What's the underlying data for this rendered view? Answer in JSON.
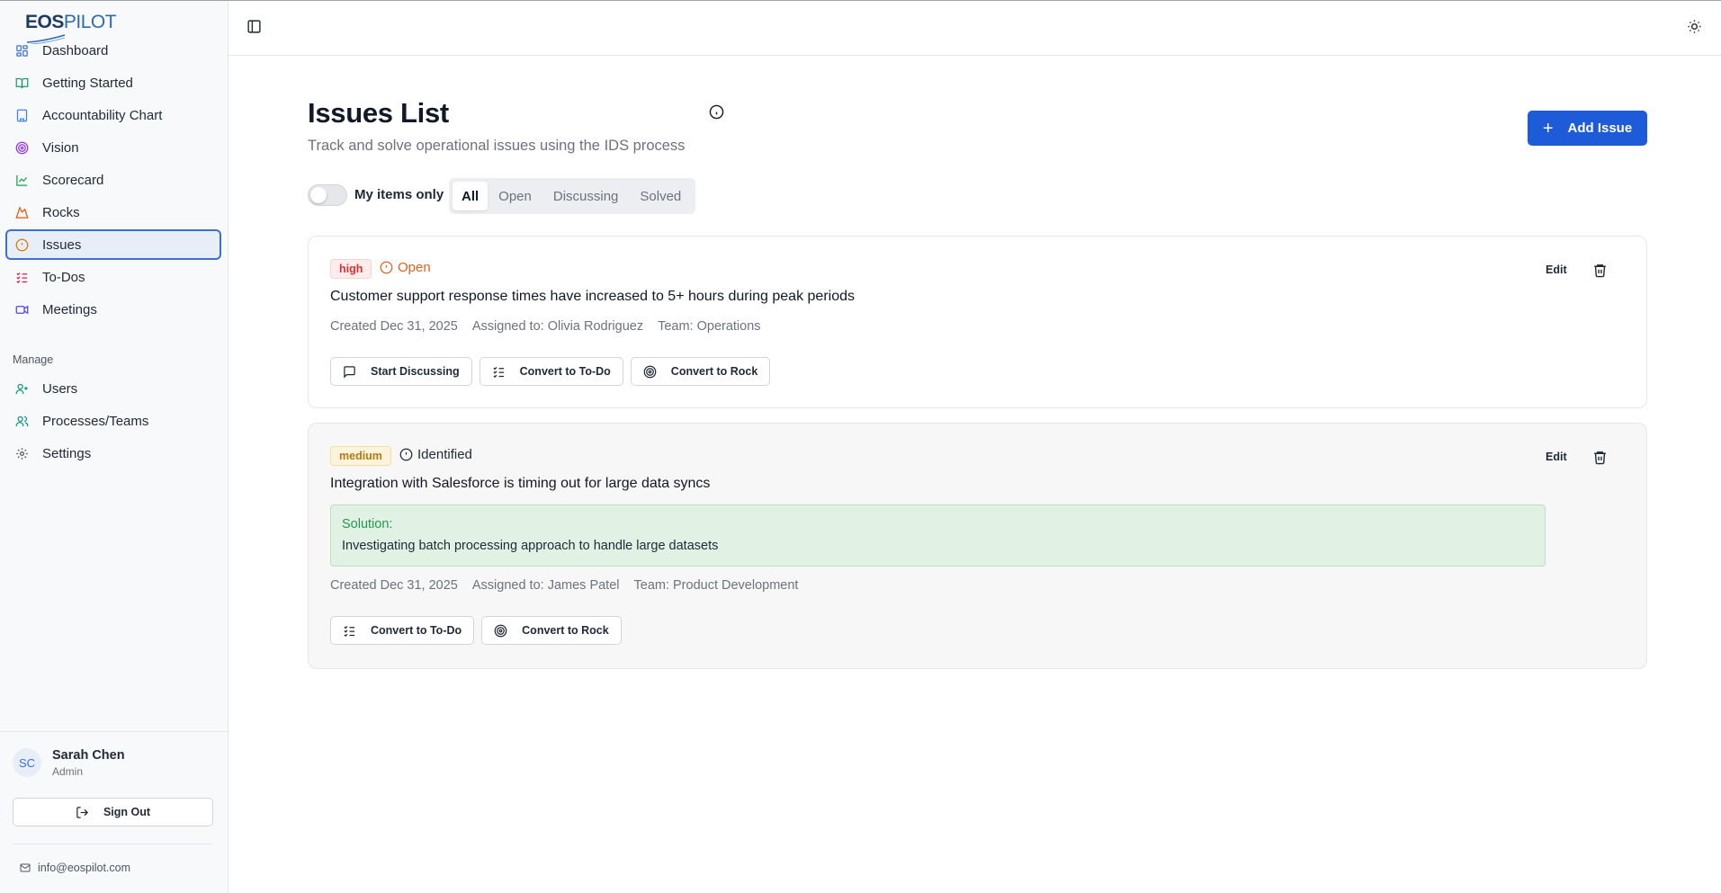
{
  "app": {
    "logo_primary": "EOS",
    "logo_secondary": "PILOT"
  },
  "sidebar": {
    "items": [
      {
        "label": "Dashboard",
        "icon": "dashboard-icon",
        "active": false
      },
      {
        "label": "Getting Started",
        "icon": "book-icon",
        "active": false
      },
      {
        "label": "Accountability Chart",
        "icon": "org-chart-icon",
        "active": false
      },
      {
        "label": "Vision",
        "icon": "target-icon",
        "active": false
      },
      {
        "label": "Scorecard",
        "icon": "chart-line-icon",
        "active": false
      },
      {
        "label": "Rocks",
        "icon": "mountain-icon",
        "active": false
      },
      {
        "label": "Issues",
        "icon": "alert-circle-icon",
        "active": true
      },
      {
        "label": "To-Dos",
        "icon": "checklist-icon",
        "active": false
      },
      {
        "label": "Meetings",
        "icon": "video-icon",
        "active": false
      }
    ],
    "section_label": "Manage",
    "manage_items": [
      {
        "label": "Users",
        "icon": "user-plus-icon"
      },
      {
        "label": "Processes/Teams",
        "icon": "users-icon"
      },
      {
        "label": "Settings",
        "icon": "gear-icon"
      }
    ],
    "user": {
      "initials": "SC",
      "name": "Sarah Chen",
      "role": "Admin"
    },
    "sign_out_label": "Sign Out",
    "email": "info@eospilot.com"
  },
  "page": {
    "title": "Issues List",
    "subtitle": "Track and solve operational issues using the IDS process",
    "add_button_label": "Add Issue",
    "my_items_label": "My items only",
    "my_items_on": false,
    "tabs": [
      {
        "label": "All",
        "active": true
      },
      {
        "label": "Open",
        "active": false
      },
      {
        "label": "Discussing",
        "active": false
      },
      {
        "label": "Solved",
        "active": false
      }
    ]
  },
  "issues": [
    {
      "priority": "high",
      "status": "Open",
      "title": "Customer support response times have increased to 5+ hours during peak periods",
      "created": "Created Dec 31, 2025",
      "assigned": "Assigned to: Olivia Rodriguez",
      "team": "Team: Operations",
      "edit_label": "Edit",
      "actions": [
        "Start Discussing",
        "Convert to To-Do",
        "Convert to Rock"
      ]
    },
    {
      "priority": "medium",
      "status": "Identified",
      "title": "Integration with Salesforce is timing out for large data syncs",
      "solution_label": "Solution:",
      "solution_text": "Investigating batch processing approach to handle large datasets",
      "created": "Created Dec 31, 2025",
      "assigned": "Assigned to: James Patel",
      "team": "Team: Product Development",
      "edit_label": "Edit",
      "actions": [
        "Convert to To-Do",
        "Convert to Rock"
      ]
    }
  ],
  "colors": {
    "accent": "#1d5bd8",
    "active_border": "#3b6fd8",
    "high": "#d93030",
    "medium": "#b27a0f",
    "open_status": "#e0621c",
    "solution_bg": "#e1f2e5",
    "solution_label": "#1e9a4a"
  }
}
